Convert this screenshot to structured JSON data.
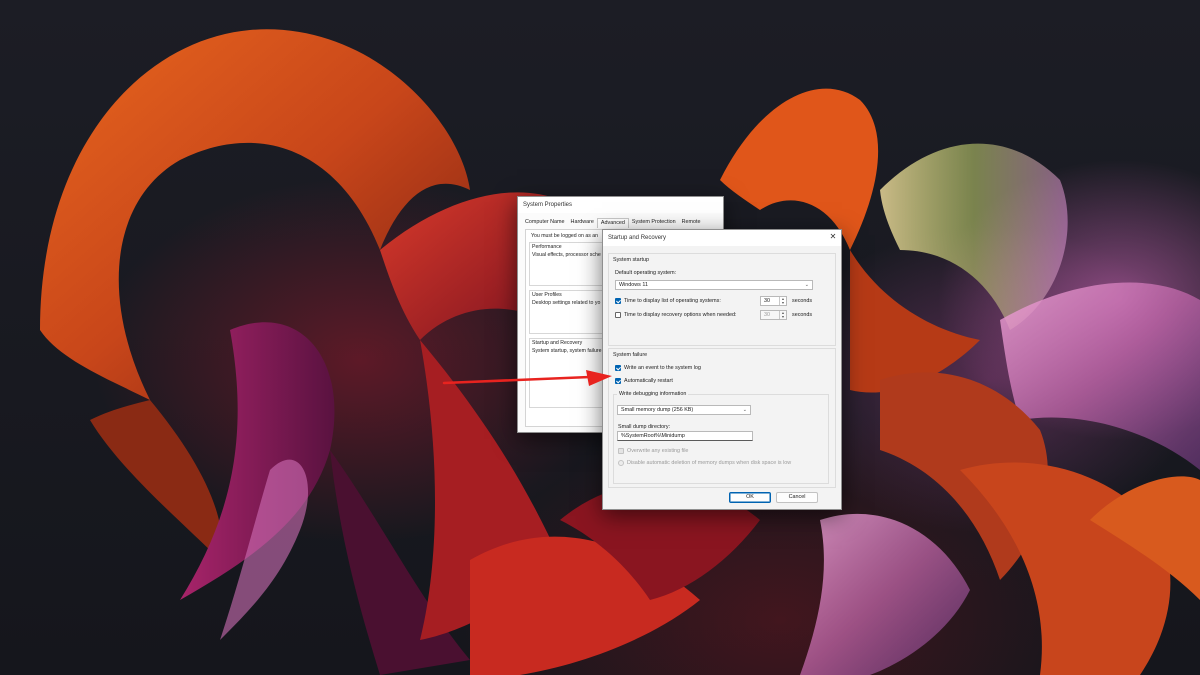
{
  "colors": {
    "accent": "#0063b1",
    "annotation_arrow": "#e8231f",
    "dialog_bg": "#f3f3f3"
  },
  "system_properties": {
    "title": "System Properties",
    "tabs": [
      "Computer Name",
      "Hardware",
      "Advanced",
      "System Protection",
      "Remote"
    ],
    "active_tab": "Advanced",
    "notice": "You must be logged on as an",
    "performance": {
      "heading": "Performance",
      "desc": "Visual effects, processor sche"
    },
    "user_profiles": {
      "heading": "User Profiles",
      "desc": "Desktop settings related to yo"
    },
    "startup_recovery": {
      "heading": "Startup and Recovery",
      "desc": "System startup, system failure"
    }
  },
  "startup_recovery": {
    "title": "Startup and Recovery",
    "close_icon": "close-icon",
    "system_startup": {
      "heading": "System startup",
      "default_os_label": "Default operating system:",
      "default_os_value": "Windows 11",
      "display_list": {
        "label": "Time to display list of operating systems:",
        "checked": true,
        "value": "30",
        "unit": "seconds"
      },
      "display_recovery": {
        "label": "Time to display recovery options when needed:",
        "checked": false,
        "value": "30",
        "unit": "seconds"
      }
    },
    "system_failure": {
      "heading": "System failure",
      "write_event": {
        "label": "Write an event to the system log",
        "checked": true
      },
      "auto_restart": {
        "label": "Automatically restart",
        "checked": true
      },
      "debug_info": {
        "heading": "Write debugging information",
        "dump_type": "Small memory dump (256 KB)",
        "dump_dir_label": "Small dump directory:",
        "dump_dir_value": "%SystemRoot%\\Minidump",
        "overwrite_label": "Overwrite any existing file",
        "disable_auto_delete_label": "Disable automatic deletion of memory dumps when disk space is low"
      }
    },
    "ok_label": "OK",
    "cancel_label": "Cancel"
  }
}
